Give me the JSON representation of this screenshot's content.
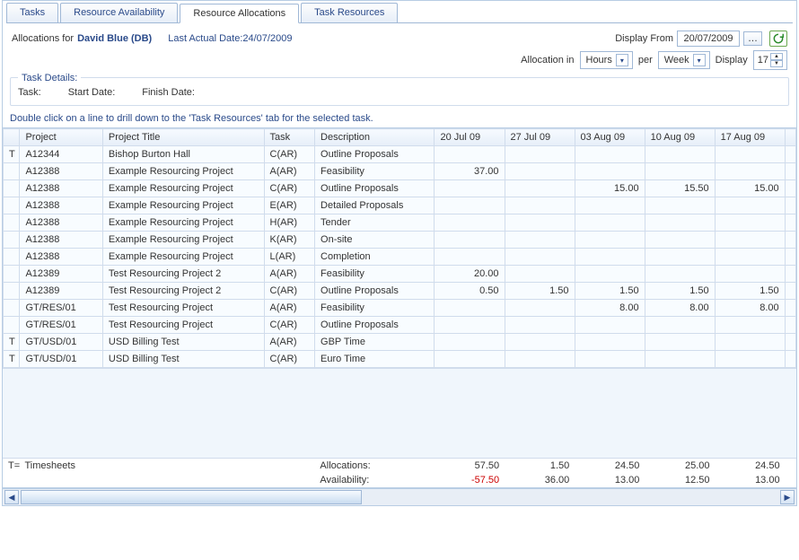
{
  "tabs": {
    "t0": "Tasks",
    "t1": "Resource Availability",
    "t2": "Resource Allocations",
    "t3": "Task Resources"
  },
  "top": {
    "prefix": "Allocations for ",
    "name": "David Blue (DB)",
    "lastActualLabel": "Last Actual Date: ",
    "lastActualDate": "24/07/2009",
    "displayFromLabel": "Display From",
    "displayFromValue": "20/07/2009",
    "allocationInLabel": "Allocation in",
    "allocationInValue": "Hours",
    "perLabel": "per",
    "perValue": "Week",
    "displayLabel": "Display",
    "displayValue": "17"
  },
  "details": {
    "legend": "Task Details:",
    "task": "Task:",
    "start": "Start Date:",
    "finish": "Finish Date:"
  },
  "hint": "Double click on a line to drill down to the 'Task Resources' tab for the selected task.",
  "columns": {
    "c0": "Project",
    "c1": "Project Title",
    "c2": "Task",
    "c3": "Description",
    "d0": "20 Jul 09",
    "d1": "27 Jul 09",
    "d2": "03 Aug 09",
    "d3": "10 Aug 09",
    "d4": "17 Aug 09"
  },
  "rows": [
    {
      "t": "T",
      "project": "A12344",
      "title": "Bishop Burton Hall",
      "task": "C(AR)",
      "desc": "Outline Proposals",
      "v": [
        "",
        "",
        "",
        "",
        ""
      ]
    },
    {
      "t": "",
      "project": "A12388",
      "title": "Example Resourcing Project",
      "task": "A(AR)",
      "desc": "Feasibility",
      "v": [
        "37.00",
        "",
        "",
        "",
        ""
      ],
      "hl": [
        0
      ]
    },
    {
      "t": "",
      "project": "A12388",
      "title": "Example Resourcing Project",
      "task": "C(AR)",
      "desc": "Outline Proposals",
      "v": [
        "",
        "",
        "15.00",
        "15.50",
        "15.00"
      ],
      "hl": [
        2,
        3,
        4
      ]
    },
    {
      "t": "",
      "project": "A12388",
      "title": "Example Resourcing Project",
      "task": "E(AR)",
      "desc": "Detailed Proposals",
      "v": [
        "",
        "",
        "",
        "",
        ""
      ]
    },
    {
      "t": "",
      "project": "A12388",
      "title": "Example Resourcing Project",
      "task": "H(AR)",
      "desc": "Tender",
      "v": [
        "",
        "",
        "",
        "",
        ""
      ]
    },
    {
      "t": "",
      "project": "A12388",
      "title": "Example Resourcing Project",
      "task": "K(AR)",
      "desc": "On-site",
      "v": [
        "",
        "",
        "",
        "",
        ""
      ]
    },
    {
      "t": "",
      "project": "A12388",
      "title": "Example Resourcing Project",
      "task": "L(AR)",
      "desc": "Completion",
      "v": [
        "",
        "",
        "",
        "",
        ""
      ]
    },
    {
      "t": "",
      "project": "A12389",
      "title": "Test Resourcing Project 2",
      "task": "A(AR)",
      "desc": "Feasibility",
      "v": [
        "20.00",
        "",
        "",
        "",
        ""
      ],
      "hl": [
        0
      ]
    },
    {
      "t": "",
      "project": "A12389",
      "title": "Test Resourcing Project 2",
      "task": "C(AR)",
      "desc": "Outline Proposals",
      "v": [
        "0.50",
        "1.50",
        "1.50",
        "1.50",
        "1.50"
      ],
      "hl": [
        0,
        1,
        2,
        3,
        4
      ]
    },
    {
      "t": "",
      "project": "GT/RES/01",
      "title": "Test Resourcing Project",
      "task": "A(AR)",
      "desc": "Feasibility",
      "v": [
        "",
        "",
        "8.00",
        "8.00",
        "8.00"
      ],
      "hl": [
        2,
        3,
        4
      ]
    },
    {
      "t": "",
      "project": "GT/RES/01",
      "title": "Test Resourcing Project",
      "task": "C(AR)",
      "desc": "Outline Proposals",
      "v": [
        "",
        "",
        "",
        "",
        ""
      ]
    },
    {
      "t": "T",
      "project": "GT/USD/01",
      "title": "USD Billing Test",
      "task": "A(AR)",
      "desc": "GBP Time",
      "v": [
        "",
        "",
        "",
        "",
        ""
      ]
    },
    {
      "t": "T",
      "project": "GT/USD/01",
      "title": "USD Billing Test",
      "task": "C(AR)",
      "desc": "Euro Time",
      "v": [
        "",
        "",
        "",
        "",
        ""
      ]
    }
  ],
  "footer": {
    "tEquals": "T=",
    "timesheets": "Timesheets",
    "allocLabel": "Allocations:",
    "availLabel": "Availability:",
    "alloc": [
      "57.50",
      "1.50",
      "24.50",
      "25.00",
      "24.50"
    ],
    "avail": [
      "-57.50",
      "36.00",
      "13.00",
      "12.50",
      "13.00"
    ]
  }
}
